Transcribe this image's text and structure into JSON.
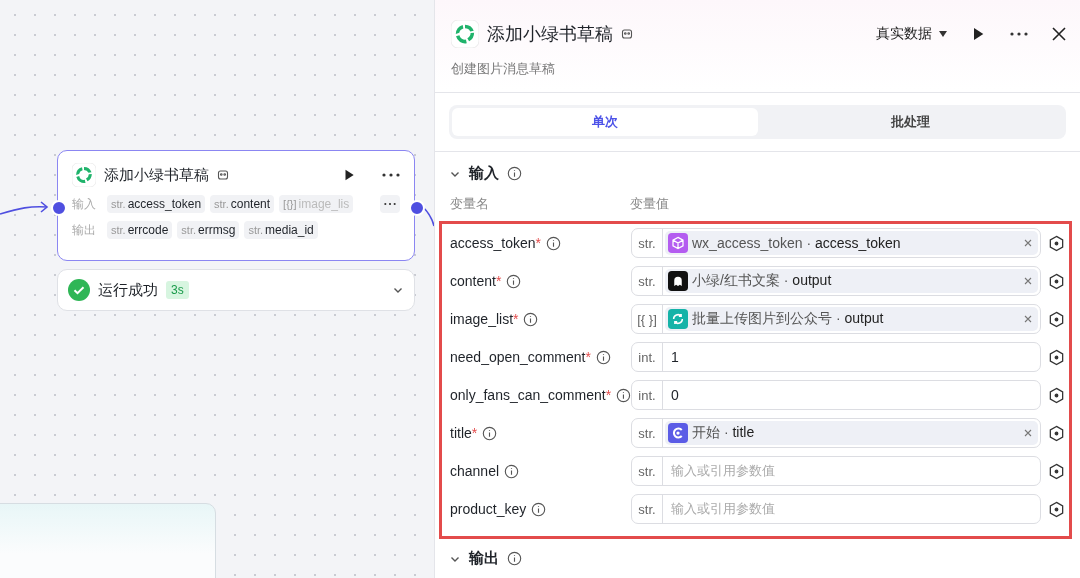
{
  "canvas": {
    "node": {
      "title": "添加小绿书草稿",
      "input_label": "输入",
      "output_label": "输出",
      "inputs": [
        {
          "type": "str.",
          "name": "access_token"
        },
        {
          "type": "str.",
          "name": "content"
        },
        {
          "type": "[{}]",
          "name": "image_lis"
        }
      ],
      "outputs": [
        {
          "type": "str.",
          "name": "errcode"
        },
        {
          "type": "str.",
          "name": "errmsg"
        },
        {
          "type": "str.",
          "name": "media_id"
        }
      ]
    },
    "status": {
      "label": "运行成功",
      "duration": "3s"
    }
  },
  "panel": {
    "title": "添加小绿书草稿",
    "subtitle": "创建图片消息草稿",
    "data_mode": "真实数据",
    "tabs": [
      {
        "label": "单次",
        "selected": true
      },
      {
        "label": "批处理",
        "selected": false
      }
    ],
    "input_section": {
      "title": "输入",
      "name_header": "变量名",
      "value_header": "变量值",
      "required_mark": "*",
      "ref_separator": "·",
      "rows": [
        {
          "name": "access_token",
          "required": true,
          "type": "str.",
          "kind": "ref",
          "color": "#b45cf0",
          "source": "wx_access_token",
          "field": "access_token"
        },
        {
          "name": "content",
          "required": true,
          "type": "str.",
          "kind": "ref",
          "color": "#111111",
          "source": "小绿/红书文案",
          "field": "output"
        },
        {
          "name": "image_list",
          "required": true,
          "type": "[{ }]",
          "kind": "ref",
          "color": "#15b3a8",
          "source": "批量上传图片到公众号",
          "field": "output"
        },
        {
          "name": "need_open_comment",
          "required": true,
          "type": "int.",
          "kind": "literal",
          "value": "1"
        },
        {
          "name": "only_fans_can_comment",
          "required": true,
          "type": "int.",
          "kind": "literal",
          "value": "0"
        },
        {
          "name": "title",
          "required": true,
          "type": "str.",
          "kind": "ref",
          "color": "#5b5ce6",
          "source": "开始",
          "field": "title"
        },
        {
          "name": "channel",
          "required": false,
          "type": "str.",
          "kind": "empty",
          "placeholder": "输入或引用参数值"
        },
        {
          "name": "product_key",
          "required": false,
          "type": "str.",
          "kind": "empty",
          "placeholder": "输入或引用参数值"
        }
      ]
    },
    "output_section": {
      "title": "输出"
    }
  }
}
